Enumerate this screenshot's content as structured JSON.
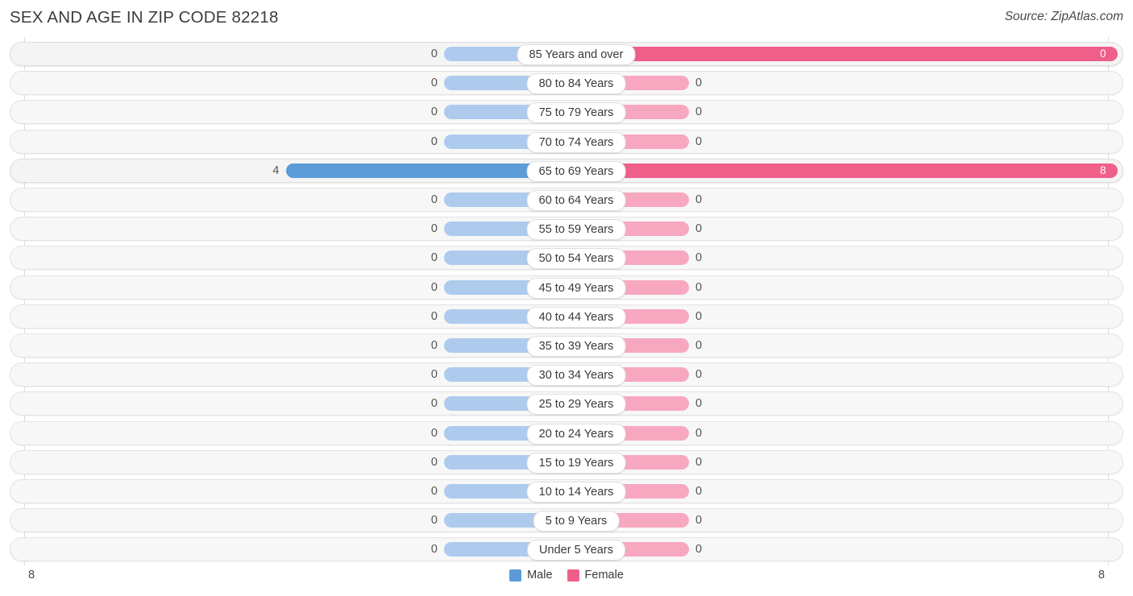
{
  "header": {
    "title": "SEX AND AGE IN ZIP CODE 82218",
    "source": "Source: ZipAtlas.com"
  },
  "axis": {
    "left_tick": "8",
    "right_tick": "8"
  },
  "legend": {
    "male_label": "Male",
    "female_label": "Female",
    "male_color": "#5b9bd8",
    "female_color": "#ef5f8a",
    "male_zero_color": "#aecbed",
    "female_zero_color": "#f7a8c0"
  },
  "chart_data": {
    "type": "bar",
    "title": "SEX AND AGE IN ZIP CODE 82218",
    "subtitle": "Source: ZipAtlas.com",
    "orientation": "horizontal-diverging",
    "xlabel": "",
    "ylabel": "",
    "xlim": [
      8,
      8
    ],
    "grid": false,
    "legend_position": "bottom-center",
    "categories": [
      "85 Years and over",
      "80 to 84 Years",
      "75 to 79 Years",
      "70 to 74 Years",
      "65 to 69 Years",
      "60 to 64 Years",
      "55 to 59 Years",
      "50 to 54 Years",
      "45 to 49 Years",
      "40 to 44 Years",
      "35 to 39 Years",
      "30 to 34 Years",
      "25 to 29 Years",
      "20 to 24 Years",
      "15 to 19 Years",
      "10 to 14 Years",
      "5 to 9 Years",
      "Under 5 Years"
    ],
    "series": [
      {
        "name": "Male",
        "values": [
          0,
          0,
          0,
          0,
          4,
          0,
          0,
          0,
          0,
          0,
          0,
          0,
          0,
          0,
          0,
          0,
          0,
          0
        ]
      },
      {
        "name": "Female",
        "values": [
          0,
          0,
          0,
          0,
          8,
          0,
          0,
          0,
          0,
          0,
          0,
          0,
          0,
          0,
          0,
          0,
          0,
          0
        ]
      }
    ],
    "rows": [
      {
        "label": "85 Years and over",
        "male": "0",
        "female": "0",
        "male_value": 0,
        "female_value": 8
      },
      {
        "label": "80 to 84 Years",
        "male": "0",
        "female": "0",
        "male_value": 0,
        "female_value": 0
      },
      {
        "label": "75 to 79 Years",
        "male": "0",
        "female": "0",
        "male_value": 0,
        "female_value": 0
      },
      {
        "label": "70 to 74 Years",
        "male": "0",
        "female": "0",
        "male_value": 0,
        "female_value": 0
      },
      {
        "label": "65 to 69 Years",
        "male": "4",
        "female": "8",
        "male_value": 4,
        "female_value": 8
      },
      {
        "label": "60 to 64 Years",
        "male": "0",
        "female": "0",
        "male_value": 0,
        "female_value": 0
      },
      {
        "label": "55 to 59 Years",
        "male": "0",
        "female": "0",
        "male_value": 0,
        "female_value": 0
      },
      {
        "label": "50 to 54 Years",
        "male": "0",
        "female": "0",
        "male_value": 0,
        "female_value": 0
      },
      {
        "label": "45 to 49 Years",
        "male": "0",
        "female": "0",
        "male_value": 0,
        "female_value": 0
      },
      {
        "label": "40 to 44 Years",
        "male": "0",
        "female": "0",
        "male_value": 0,
        "female_value": 0
      },
      {
        "label": "35 to 39 Years",
        "male": "0",
        "female": "0",
        "male_value": 0,
        "female_value": 0
      },
      {
        "label": "30 to 34 Years",
        "male": "0",
        "female": "0",
        "male_value": 0,
        "female_value": 0
      },
      {
        "label": "25 to 29 Years",
        "male": "0",
        "female": "0",
        "male_value": 0,
        "female_value": 0
      },
      {
        "label": "20 to 24 Years",
        "male": "0",
        "female": "0",
        "male_value": 0,
        "female_value": 0
      },
      {
        "label": "15 to 19 Years",
        "male": "0",
        "female": "0",
        "male_value": 0,
        "female_value": 0
      },
      {
        "label": "10 to 14 Years",
        "male": "0",
        "female": "0",
        "male_value": 0,
        "female_value": 0
      },
      {
        "label": "5 to 9 Years",
        "male": "0",
        "female": "0",
        "male_value": 0,
        "female_value": 0
      },
      {
        "label": "Under 5 Years",
        "male": "0",
        "female": "0",
        "male_value": 0,
        "female_value": 0
      }
    ]
  }
}
